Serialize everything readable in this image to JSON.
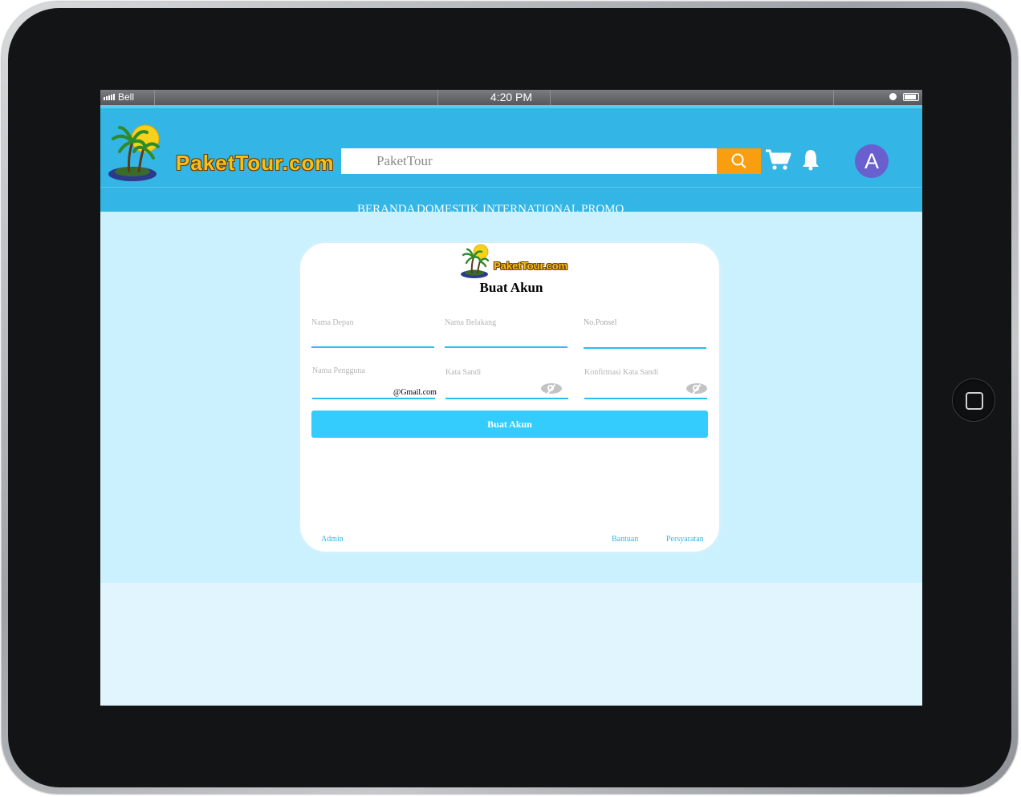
{
  "device": {
    "frame": "ipad"
  },
  "statusbar": {
    "carrier": "Bell",
    "time": "4:20 PM"
  },
  "header": {
    "logo_text": "PaketTour.com",
    "search_placeholder": "PaketTour",
    "avatar_letter": "A",
    "icons": [
      "palm-island-logo",
      "search-icon",
      "cart-icon",
      "bell-icon"
    ],
    "colors": {
      "header_bg": "#33b6e5",
      "search_button": "#f99f0f",
      "avatar": "#6a5fcf"
    }
  },
  "nav": {
    "items": [
      {
        "label": "BERANDA"
      },
      {
        "label": "DOMESTIK"
      },
      {
        "label": "INTERNATIONAL"
      },
      {
        "label": "PROMO"
      }
    ]
  },
  "card": {
    "logo_text": "PaketTour.com",
    "title": "Buat Akun",
    "fields": {
      "first_name": {
        "label": "Nama Depan",
        "value": ""
      },
      "last_name": {
        "label": "Nama Belakang",
        "value": ""
      },
      "phone": {
        "label": "No.Ponsel",
        "value": ""
      },
      "username": {
        "label": "Nama Pengguna",
        "value": "",
        "suffix": "@Gmail.com"
      },
      "password": {
        "label": "Kata Sandi",
        "value": ""
      },
      "confirm_password": {
        "label": "Konfirmasi Kata Sandi",
        "value": ""
      }
    },
    "submit_label": "Buat Akun",
    "footer": {
      "admin": "Admin",
      "help": "Bantuan",
      "terms": "Persyaratan"
    },
    "colors": {
      "accent": "#33ccfd",
      "card_bg": "#ffffff",
      "page_bg": "#ccf1fe"
    }
  }
}
